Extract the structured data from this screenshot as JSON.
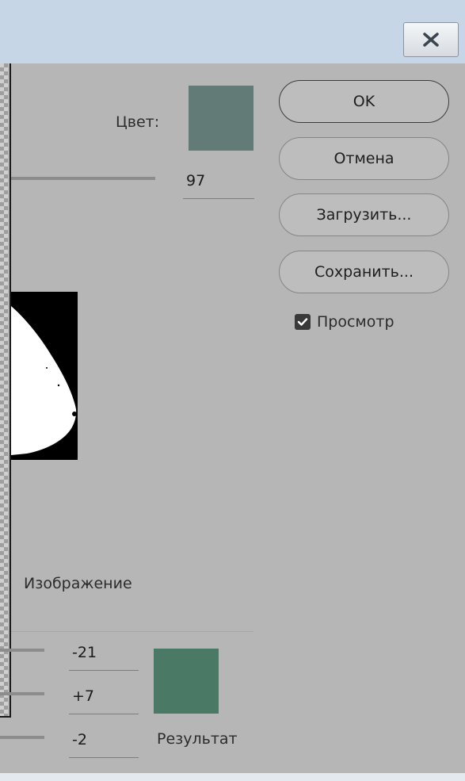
{
  "titlebar": {
    "close_icon": "close-icon"
  },
  "color_picker": {
    "label": "Цвет:",
    "swatch_color": "#627b76"
  },
  "fuzziness": {
    "value": "97"
  },
  "buttons": {
    "ok": "OK",
    "cancel": "Отмена",
    "load": "Загрузить...",
    "save": "Сохранить..."
  },
  "preview": {
    "label": "Просмотр",
    "checked": true
  },
  "image_mode": {
    "label": "Изображение"
  },
  "adjust": {
    "values": [
      "-21",
      "+7",
      "-2"
    ],
    "result_label": "Результат",
    "result_color": "#4a7a65"
  }
}
